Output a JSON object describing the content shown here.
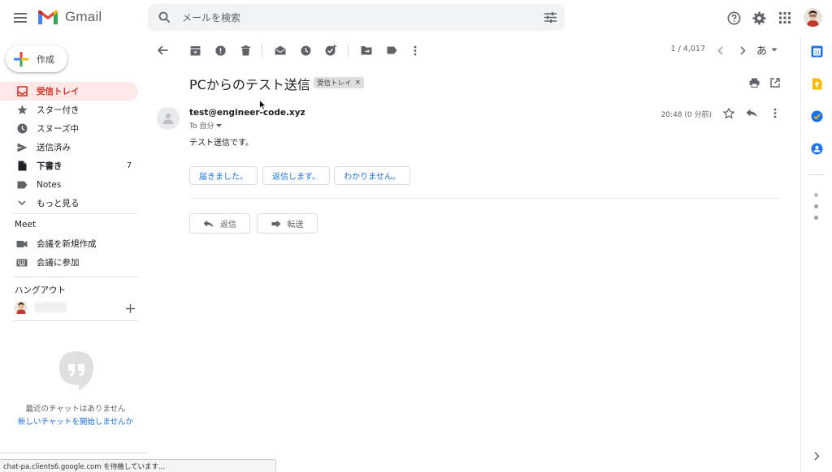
{
  "header": {
    "app_name": "Gmail",
    "search_placeholder": "メールを検索"
  },
  "sidebar": {
    "compose_label": "作成",
    "items": [
      {
        "label": "受信トレイ",
        "icon": "inbox-icon",
        "active": true,
        "count": ""
      },
      {
        "label": "スター付き",
        "icon": "star-icon",
        "active": false,
        "count": ""
      },
      {
        "label": "スヌーズ中",
        "icon": "clock-icon",
        "active": false,
        "count": ""
      },
      {
        "label": "送信済み",
        "icon": "send-icon",
        "active": false,
        "count": ""
      },
      {
        "label": "下書き",
        "icon": "draft-icon",
        "active": false,
        "count": "7"
      },
      {
        "label": "Notes",
        "icon": "label-icon",
        "active": false,
        "count": ""
      },
      {
        "label": "もっと見る",
        "icon": "chevron-down-icon",
        "active": false,
        "count": ""
      }
    ],
    "meet": {
      "title": "Meet",
      "items": [
        {
          "label": "会議を新規作成",
          "icon": "video-icon"
        },
        {
          "label": "会議に参加",
          "icon": "keyboard-icon"
        }
      ]
    },
    "hangouts": {
      "title": "ハングアウト",
      "empty_text": "最近のチャットはありません",
      "start_link": "新しいチャットを開始しませんか"
    }
  },
  "toolbar": {
    "pager": "1 / 4,017",
    "ime": "あ"
  },
  "message": {
    "subject": "PCからのテスト送信",
    "label_chip": "受信トレイ",
    "sender": "test@engineer-code.xyz",
    "to": "To 自分",
    "time": "20:48 (0 分前)",
    "body": "テスト送信です。",
    "smart_replies": [
      "届きました。",
      "返信します。",
      "わかりません。"
    ],
    "reply_label": "返信",
    "forward_label": "転送"
  },
  "statusbar": {
    "text": "chat-pa.clients6.google.com を待機しています..."
  },
  "colors": {
    "accent_red": "#d93025",
    "active_bg": "#fce8e6",
    "link_blue": "#1a73e8",
    "search_bg": "#f1f3f4"
  }
}
